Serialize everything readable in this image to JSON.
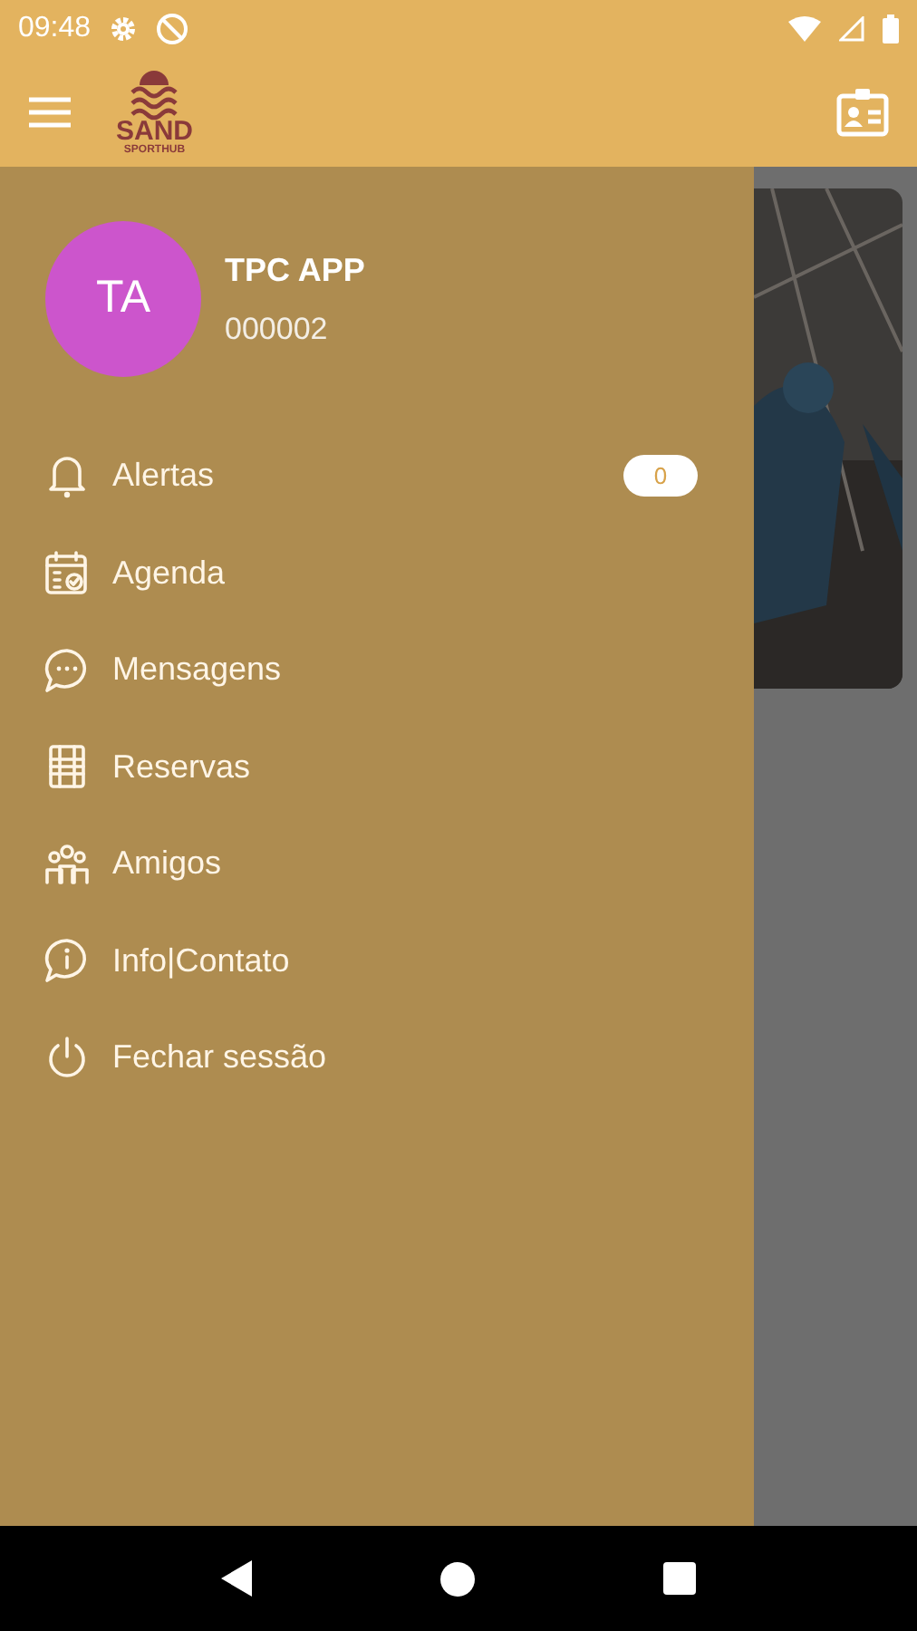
{
  "status_bar": {
    "time": "09:48"
  },
  "app_bar": {
    "logo": {
      "title": "SAND",
      "subtitle": "SPORTHUB"
    }
  },
  "drawer": {
    "profile": {
      "initials": "TA",
      "name": "TPC APP",
      "code": "000002",
      "color": "#cc55cc"
    },
    "items": [
      {
        "kind": "alerts",
        "label": "Alertas",
        "badge": "0"
      },
      {
        "kind": "agenda",
        "label": "Agenda"
      },
      {
        "kind": "messages",
        "label": "Mensagens"
      },
      {
        "kind": "bookings",
        "label": "Reservas"
      },
      {
        "kind": "friends",
        "label": "Amigos"
      },
      {
        "kind": "info",
        "label": "Info|Contato"
      },
      {
        "kind": "logout",
        "label": "Fechar sessão"
      }
    ]
  }
}
